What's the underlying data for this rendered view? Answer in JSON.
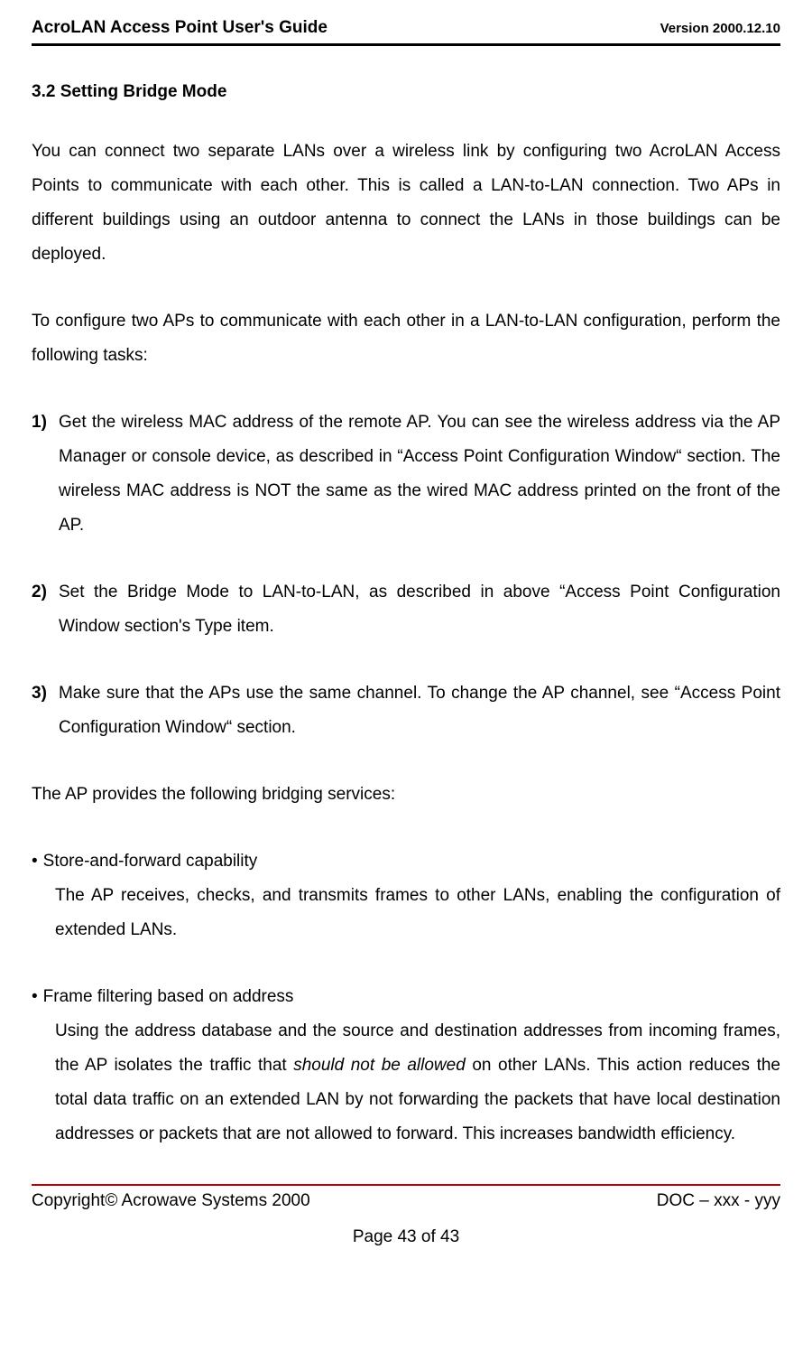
{
  "header": {
    "title": "AcroLAN Access Point User's Guide",
    "version": "Version 2000.12.10"
  },
  "section_heading": "3.2 Setting Bridge Mode",
  "para1": "You can connect two separate LANs over a wireless link by configuring two AcroLAN Access Points to communicate with each other. This is called a LAN-to-LAN connection. Two APs in different buildings using an outdoor antenna to connect the LANs in those buildings can be deployed.",
  "para2": "To configure two APs to communicate with each other in a LAN-to-LAN configuration, perform the following tasks:",
  "steps": {
    "s1_num": "1)",
    "s1_body": "Get the wireless MAC address of the remote AP. You can see the wireless address via the AP Manager or console device, as described in “Access Point Configuration Window“ section. The wireless MAC address is NOT the same as the wired MAC address printed on the front of the AP.",
    "s2_num": "2)",
    "s2_body": "Set the Bridge Mode to LAN-to-LAN, as described in above “Access Point Configuration Window section's Type item.",
    "s3_num": "3)",
    "s3_body": "Make sure that the APs use the same channel. To change the AP channel, see “Access Point Configuration Window“ section."
  },
  "para3": "The AP provides the following bridging services:",
  "bullets": {
    "b1_title": "Store-and-forward capability",
    "b1_body": "The AP receives, checks, and transmits frames to other LANs, enabling the configuration of extended LANs.",
    "b2_title": "Frame filtering based on address",
    "b2_body_pre": "Using the address database and the source and destination addresses from incoming frames, the AP isolates the traffic that ",
    "b2_body_em": "should not be allowed",
    "b2_body_post": " on other LANs. This action reduces the total data traffic on an extended LAN by not forwarding the packets that have local destination addresses or packets that are not allowed to forward. This increases bandwidth efficiency."
  },
  "footer": {
    "copyright": "Copyright© Acrowave Systems 2000",
    "doc": "DOC – xxx - yyy",
    "page": "Page 43 of 43"
  }
}
